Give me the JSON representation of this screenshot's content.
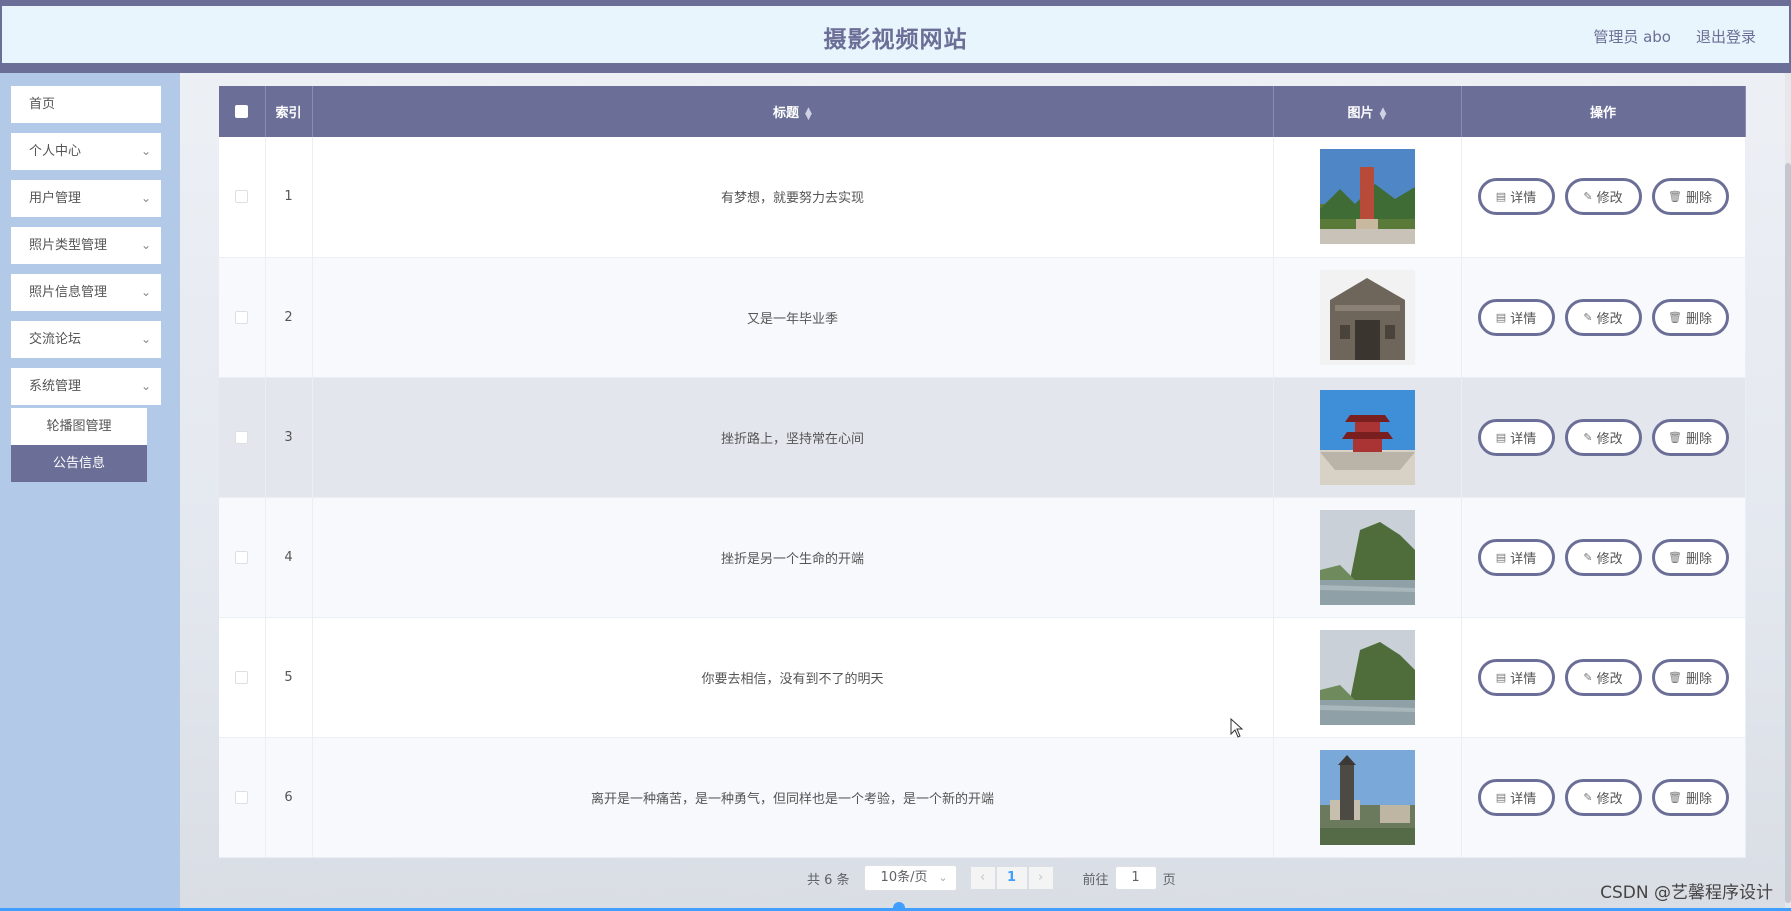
{
  "header": {
    "title": "摄影视频网站",
    "admin": "管理员 abo",
    "logout": "退出登录"
  },
  "sidebar": {
    "items": [
      {
        "label": "首页",
        "has_chevron": false
      },
      {
        "label": "个人中心",
        "has_chevron": true
      },
      {
        "label": "用户管理",
        "has_chevron": true
      },
      {
        "label": "照片类型管理",
        "has_chevron": true
      },
      {
        "label": "照片信息管理",
        "has_chevron": true
      },
      {
        "label": "交流论坛",
        "has_chevron": true
      },
      {
        "label": "系统管理",
        "has_chevron": true
      }
    ],
    "submenu": [
      {
        "label": "轮播图管理",
        "active": false
      },
      {
        "label": "公告信息",
        "active": true
      }
    ]
  },
  "table": {
    "headers": {
      "index": "索引",
      "title": "标题",
      "image": "图片",
      "actions": "操作"
    },
    "rows": [
      {
        "index": "1",
        "title": "有梦想，就要努力去实现",
        "image_icon": "temple-photo"
      },
      {
        "index": "2",
        "title": "又是一年毕业季",
        "image_icon": "old-gate-photo"
      },
      {
        "index": "3",
        "title": "挫折路上，坚持常在心间",
        "image_icon": "pagoda-photo"
      },
      {
        "index": "4",
        "title": "挫折是另一个生命的开端",
        "image_icon": "river-hill-photo"
      },
      {
        "index": "5",
        "title": "你要去相信，没有到不了的明天",
        "image_icon": "river-hill-photo"
      },
      {
        "index": "6",
        "title": "离开是一种痛苦，是一种勇气，但同样也是一个考验，是一个新的开端",
        "image_icon": "monument-photo"
      }
    ],
    "row_actions": {
      "detail": "详情",
      "edit": "修改",
      "delete": "删除"
    }
  },
  "pagination": {
    "total": "共 6 条",
    "page_size": "10条/页",
    "current_page": "1",
    "goto_label": "前往",
    "goto_value": "1",
    "goto_suffix": "页"
  },
  "watermark": "CSDN @艺馨程序设计",
  "colors": {
    "primary": "#6b6e96",
    "sidebar_bg": "#b3c9e8",
    "header_bg": "#e9f5fc",
    "highlight_row": "#e4e6ee"
  }
}
